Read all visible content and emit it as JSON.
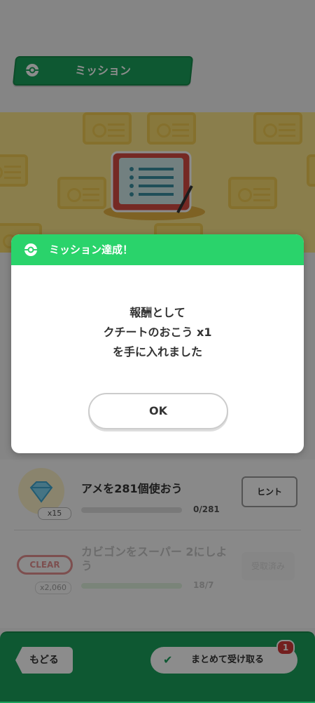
{
  "header": {
    "title": "ミッション"
  },
  "missions": [
    {
      "title": "アメを281個使おう",
      "reward_count": "x15",
      "progress": "0/281",
      "button": "ヒント"
    },
    {
      "status": "CLEAR",
      "title_line1": "カビゴンをスーパー 2にしよ",
      "title_line2": "う",
      "reward_count": "x2,060",
      "progress": "18/7",
      "button": "受取済み"
    }
  ],
  "footer": {
    "back_label": "もどる",
    "claim_all_label": "まとめて受け取る",
    "badge_count": "1"
  },
  "dialog": {
    "title": "ミッション達成！",
    "line1": "報酬として",
    "line2": "クチートのおこう x1",
    "line3": "を手に入れました",
    "ok_label": "OK"
  },
  "colors": {
    "green": "#1ba15b",
    "dialog_header": "#2ad36b",
    "clear_red": "#d23a3a",
    "banner_yellow": "#fbe58a"
  }
}
